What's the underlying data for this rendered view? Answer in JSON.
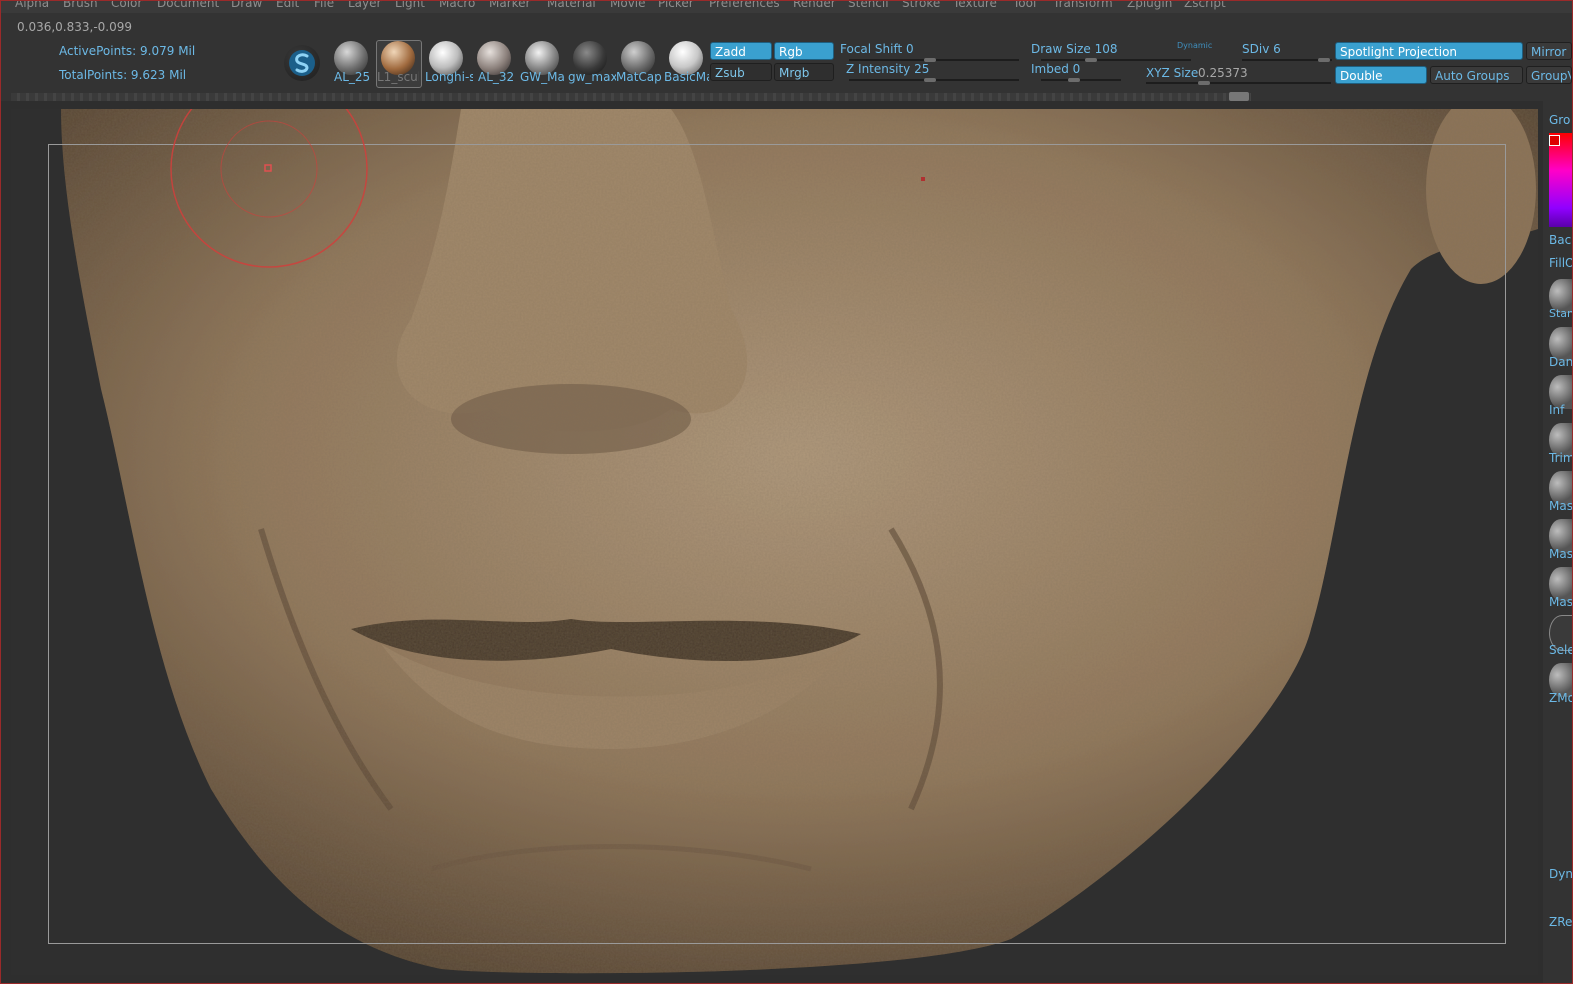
{
  "menu": [
    "Alpha",
    "Brush",
    "Color",
    "Document",
    "Draw",
    "Edit",
    "File",
    "Layer",
    "Light",
    "Macro",
    "Marker",
    "Material",
    "Movie",
    "Picker",
    "Preferences",
    "Render",
    "Stencil",
    "Stroke",
    "Texture",
    "Tool",
    "Transform",
    "Zplugin",
    "Zscript"
  ],
  "status": {
    "coords": "0.036,0.833,-0.099",
    "active_points": "ActivePoints: 9.079 Mil",
    "total_points": "TotalPoints: 9.623 Mil"
  },
  "materials": [
    "AL_25",
    "L1_sculp",
    "Longhi-s",
    "AL_32",
    "GW_Ma",
    "gw_max",
    "MatCap",
    "BasicMa"
  ],
  "buttons": {
    "zadd": "Zadd",
    "zsub": "Zsub",
    "rgb": "Rgb",
    "mrgb": "Mrgb",
    "spotlight": "Spotlight Projection",
    "double": "Double",
    "auto_groups": "Auto Groups",
    "mirror": "Mirror",
    "groups": "GroupV"
  },
  "sliders": {
    "focal_shift": "Focal Shift 0",
    "z_intensity": "Z Intensity 25",
    "draw_size": "Draw Size 108",
    "dynamic": "Dynamic",
    "imbed": "Imbed 0",
    "sdiv": "SDiv 6",
    "xyz_size_label": "XYZ Size",
    "xyz_size_value": "0.25373"
  },
  "tray": [
    "Gro",
    "Bac",
    "FillO",
    "Stan",
    "Dan",
    "Inf",
    "Trim",
    "Mas",
    "Mas",
    "Mas",
    "Sele",
    "ZMo",
    "Dyn",
    "ZRe"
  ],
  "colors": {
    "accent": "#3aa0cf",
    "text_accent": "#6cb9e6",
    "skin": "#9c8466",
    "cursor": "#d0403c"
  }
}
